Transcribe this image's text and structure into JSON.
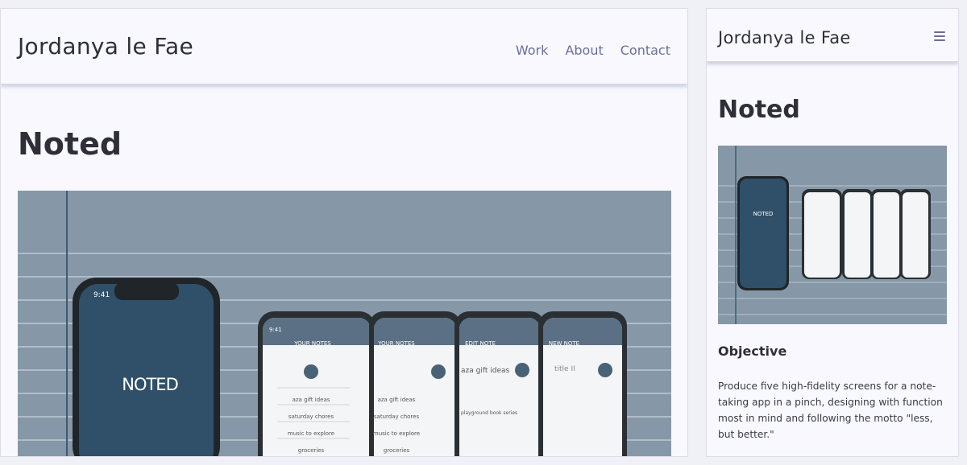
{
  "site": {
    "brand": "Jordanya le Fae",
    "nav": [
      "Work",
      "About",
      "Contact"
    ]
  },
  "project": {
    "title": "Noted",
    "objective_heading": "Objective",
    "objective_text": "Produce five high-fidelity screens for a note-taking app in a pinch, designing with function most in mind and following the motto \"less, but better.\""
  },
  "mockup": {
    "splash_time": "9:41",
    "splash_logo": "NOTED",
    "phone_time": "9:41",
    "screens": [
      {
        "header": "YOUR NOTES",
        "items": [
          "aza gift ideas",
          "saturday chores",
          "music to explore",
          "groceries"
        ]
      },
      {
        "header": "YOUR NOTES",
        "items": [
          "aza gift ideas",
          "saturday chores",
          "music to explore",
          "groceries"
        ]
      },
      {
        "header": "EDIT NOTE",
        "items": [
          "aza gift ideas",
          "playground book series"
        ]
      },
      {
        "header": "NEW NOTE",
        "items": [
          "title II"
        ]
      }
    ]
  },
  "colors": {
    "nav_link": "#6b6e9a",
    "hero_bg": "#8698a7",
    "phone_splash": "#2f5068"
  }
}
